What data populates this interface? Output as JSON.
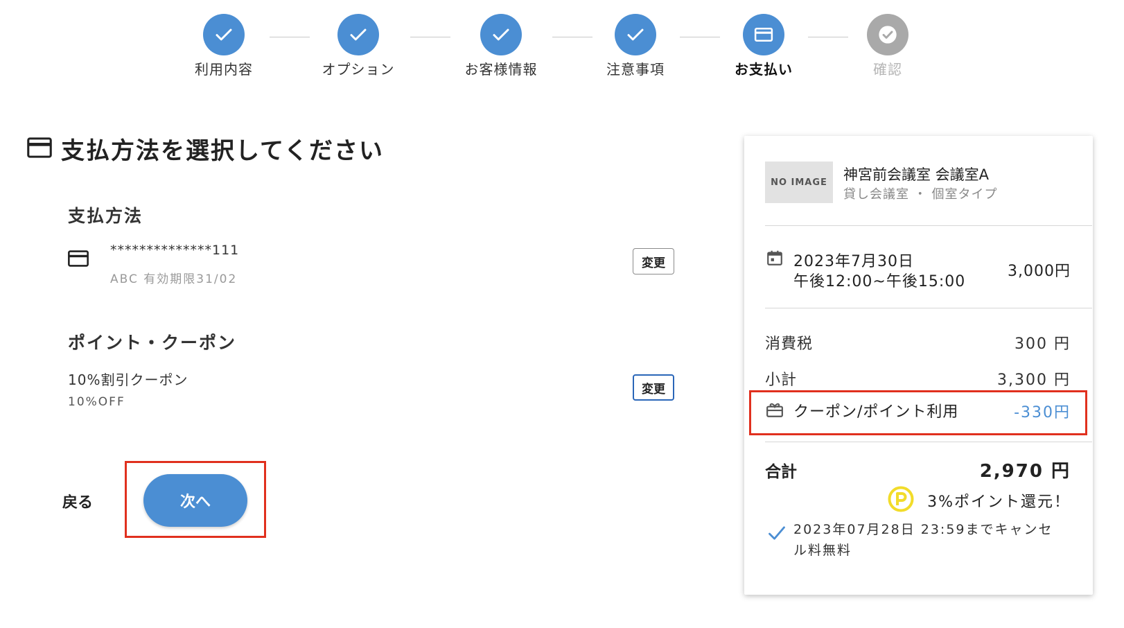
{
  "stepper": {
    "steps": [
      {
        "label": "利用内容",
        "state": "done"
      },
      {
        "label": "オプション",
        "state": "done"
      },
      {
        "label": "お客様情報",
        "state": "done"
      },
      {
        "label": "注意事項",
        "state": "done"
      },
      {
        "label": "お支払い",
        "state": "active"
      },
      {
        "label": "確認",
        "state": "pending"
      }
    ]
  },
  "page": {
    "title": "支払方法を選択してください"
  },
  "payment": {
    "section_title": "支払方法",
    "card_masked": "**************111",
    "card_detail": "ABC 有効期限31/02",
    "change_label": "変更"
  },
  "coupon": {
    "section_title": "ポイント・クーポン",
    "name": "10%割引クーポン",
    "discount": "10%OFF",
    "change_label": "変更"
  },
  "actions": {
    "back_label": "戻る",
    "next_label": "次へ"
  },
  "summary": {
    "no_image_label": "NO IMAGE",
    "room_name": "神宮前会議室 会議室A",
    "room_type": "貸し会議室 ・ 個室タイプ",
    "date_line": "2023年7月30日",
    "time_line": "午後12:00~午後15:00",
    "base_price": "3,000円",
    "tax_label": "消費税",
    "tax_value": "300 円",
    "subtotal_label": "小計",
    "subtotal_value": "3,300 円",
    "coupon_label": "クーポン/ポイント利用",
    "coupon_value": "-330円",
    "total_label": "合計",
    "total_value": "2,970 円",
    "points_note": "3%ポイント還元！",
    "cancel_note": "2023年07月28日 23:59までキャンセル料無料"
  },
  "colors": {
    "accent": "#4b8ed3",
    "pending": "#a9a9a9",
    "highlight": "#e0301e",
    "points_yellow": "#f2dc2a"
  },
  "icons": [
    "check-icon",
    "credit-card-icon",
    "calendar-icon",
    "coupon-icon",
    "points-p-icon"
  ]
}
